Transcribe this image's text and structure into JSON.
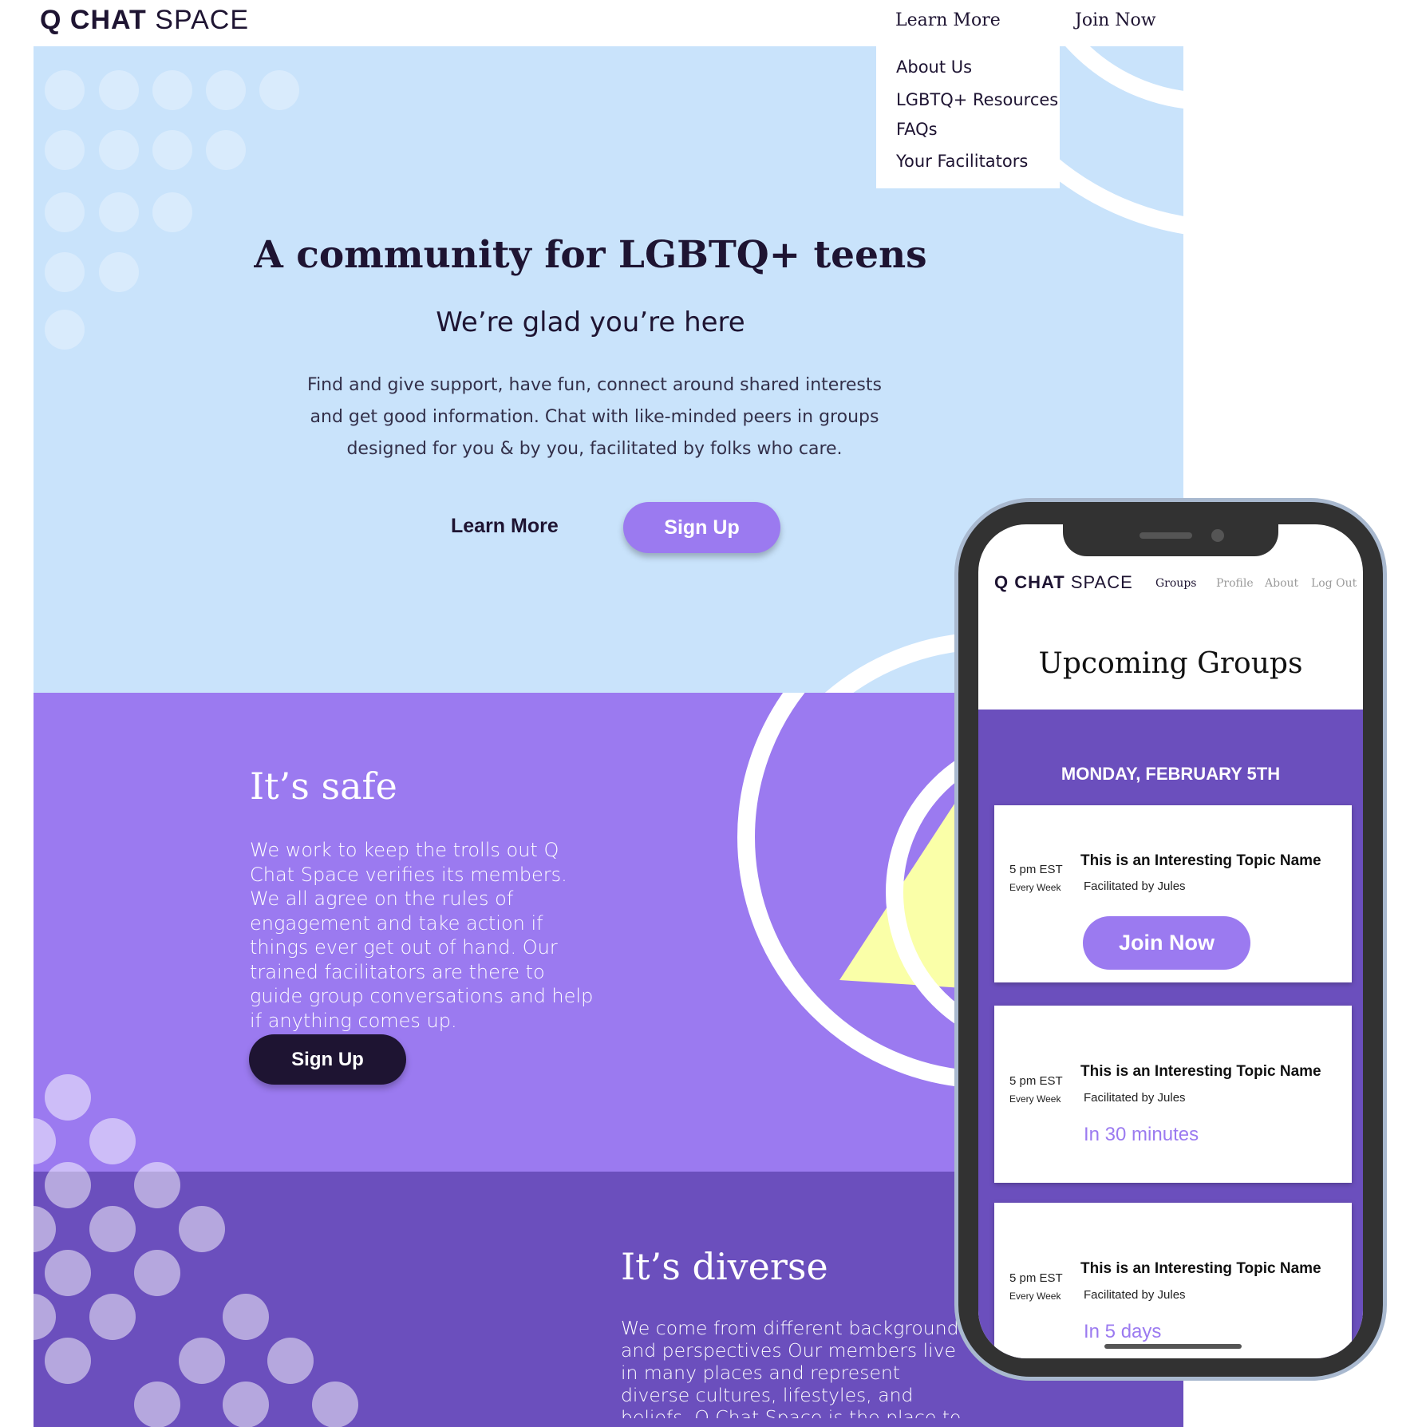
{
  "header": {
    "logo_bold": "Q CHAT",
    "logo_light": "SPACE",
    "nav_learn_more": "Learn More",
    "nav_join_now": "Join Now"
  },
  "dropdown": {
    "items": [
      "About Us",
      "LGBTQ+ Resources",
      "FAQs",
      "Your Facilitators"
    ]
  },
  "hero": {
    "title": "A community for LGBTQ+ teens",
    "subtitle": "We’re glad you’re here",
    "body_lines": [
      "Find and give support, have fun, connect around shared interests",
      "and get good information. Chat with like-minded peers in groups",
      "designed for you & by you, facilitated by folks who care."
    ],
    "learn_more": "Learn More",
    "sign_up": "Sign Up"
  },
  "safe": {
    "title": "It’s safe",
    "body": "We work to keep the trolls out  Q Chat Space verifies its members. We all agree on the rules of engagement and take action if things ever get out of hand. Our trained facilitators are there to guide group conversations and help if anything comes up.",
    "sign_up": "Sign Up"
  },
  "diverse": {
    "title": "It’s diverse",
    "body": "We come from different backgrounds and perspectives  Our members live in many places and represent diverse cultures, lifestyles, and beliefs. Q Chat Space is the place to meet a wide range of friends and"
  },
  "phone": {
    "logo_bold": "Q CHAT",
    "logo_light": "SPACE",
    "nav": [
      "Groups",
      "Profile",
      "About",
      "Log Out"
    ],
    "title": "Upcoming Groups",
    "date": "MONDAY, FEBRUARY 5TH",
    "cards": [
      {
        "time": "5 pm EST",
        "freq": "Every Week",
        "topic": "This is an Interesting Topic Name",
        "facilitator": "Facilitated by Jules",
        "action": "Join Now"
      },
      {
        "time": "5 pm EST",
        "freq": "Every Week",
        "topic": "This is an Interesting Topic Name",
        "facilitator": "Facilitated by Jules",
        "when": "In 30 minutes"
      },
      {
        "time": "5 pm EST",
        "freq": "Every Week",
        "topic": "This is an Interesting Topic Name",
        "facilitator": "Facilitated by Jules",
        "when": "In 5 days"
      }
    ]
  },
  "colors": {
    "light_blue": "#c9e3fb",
    "purple": "#9b7af0",
    "dark_purple": "#6b4fbd",
    "navy": "#1e1432",
    "yellow": "#faffa8"
  }
}
